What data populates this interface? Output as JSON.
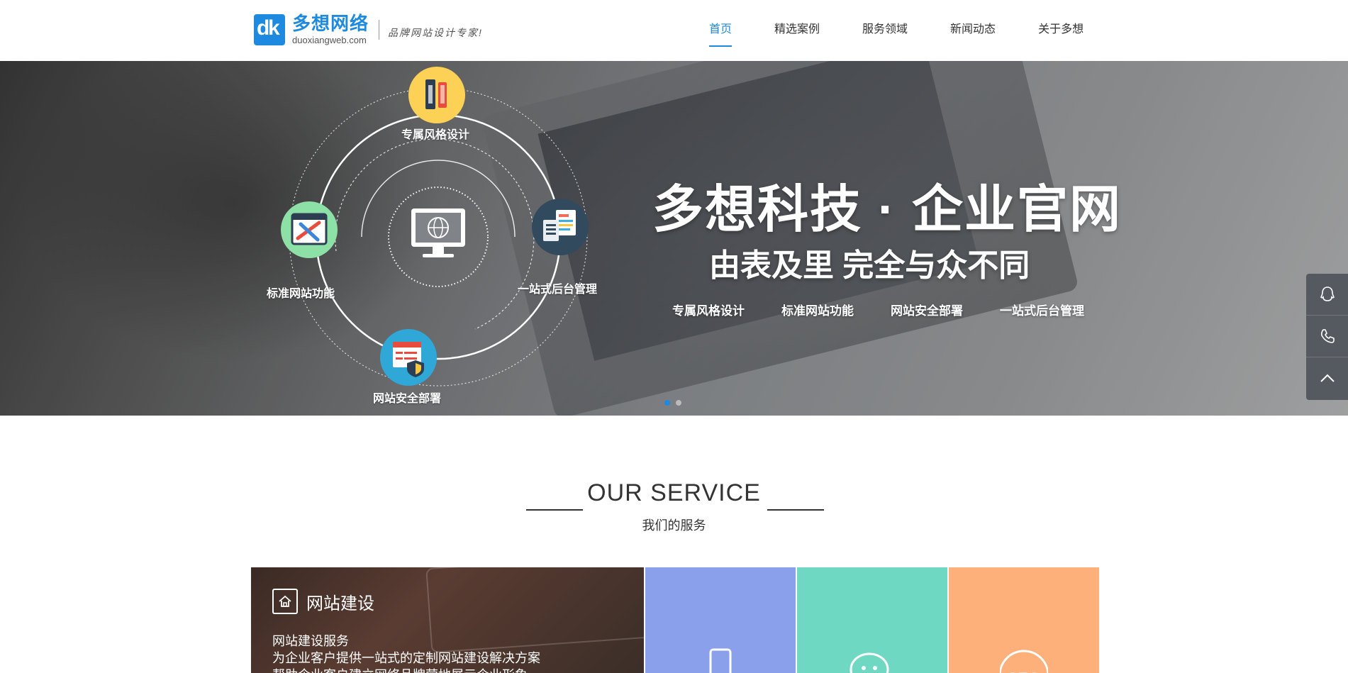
{
  "header": {
    "logo": {
      "name": "多想网络",
      "url": "duoxiangweb.com",
      "slogan": "品牌网站设计专家!"
    },
    "nav": [
      {
        "label": "首页",
        "active": true
      },
      {
        "label": "精选案例",
        "active": false
      },
      {
        "label": "服务领域",
        "active": false
      },
      {
        "label": "新闻动态",
        "active": false
      },
      {
        "label": "关于多想",
        "active": false
      }
    ]
  },
  "banner": {
    "title": "多想科技 · 企业官网",
    "subtitle": "由表及里 完全与众不同",
    "tags": [
      "专属风格设计",
      "标准网站功能",
      "网站安全部署",
      "一站式后台管理"
    ],
    "diagram_labels": {
      "top": "专属风格设计",
      "left": "标准网站功能",
      "right": "一站式后台管理",
      "bottom": "网站安全部署"
    },
    "slide_count": 2,
    "active_slide": 1
  },
  "side_tools": [
    {
      "icon": "qq-icon"
    },
    {
      "icon": "phone-icon"
    },
    {
      "icon": "back-to-top-icon"
    }
  ],
  "service": {
    "title": "OUR SERVICE",
    "subtitle": "我们的服务",
    "main_card": {
      "title": "网站建设",
      "lines": [
        "网站建设服务",
        "为企业客户提供一站式的定制网站建设解决方案",
        "帮助企业客户建立网络品牌营地展示企业形象"
      ]
    },
    "cards": [
      {
        "icon": "mobile-icon",
        "color": "#8aa0ea"
      },
      {
        "icon": "wechat-icon",
        "color": "#6fd8c3"
      },
      {
        "icon": "seo-icon",
        "color": "#fdb07a"
      }
    ]
  },
  "colors": {
    "brand": "#1d8ae0"
  }
}
